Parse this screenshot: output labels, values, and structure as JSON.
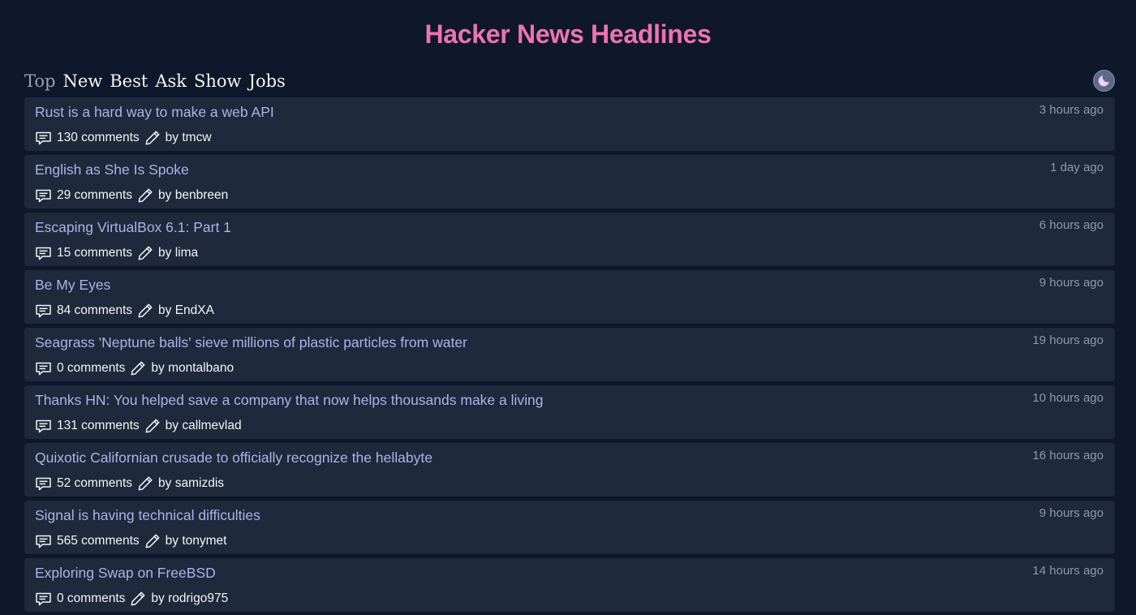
{
  "header": {
    "title": "Hacker News Headlines"
  },
  "nav": {
    "tabs": [
      {
        "label": "Top",
        "active": true
      },
      {
        "label": "New",
        "active": false
      },
      {
        "label": "Best",
        "active": false
      },
      {
        "label": "Ask",
        "active": false
      },
      {
        "label": "Show",
        "active": false
      },
      {
        "label": "Jobs",
        "active": false
      }
    ],
    "theme_toggle_icon": "moon-icon"
  },
  "colors": {
    "background": "#0f172a",
    "card": "#1e293b",
    "title_accent": "#ec73b4",
    "story_title": "#aab4e8",
    "muted_text": "#8f98aa",
    "text": "#f1f5f9"
  },
  "stories": [
    {
      "title": "Rust is a hard way to make a web API",
      "time": "3 hours ago",
      "comments": "130 comments",
      "author": "by tmcw"
    },
    {
      "title": "English as She Is Spoke",
      "time": "1 day ago",
      "comments": "29 comments",
      "author": "by benbreen"
    },
    {
      "title": "Escaping VirtualBox 6.1: Part 1",
      "time": "6 hours ago",
      "comments": "15 comments",
      "author": "by lima"
    },
    {
      "title": "Be My Eyes",
      "time": "9 hours ago",
      "comments": "84 comments",
      "author": "by EndXA"
    },
    {
      "title": "Seagrass 'Neptune balls' sieve millions of plastic particles from water",
      "time": "19 hours ago",
      "comments": "0 comments",
      "author": "by montalbano"
    },
    {
      "title": "Thanks HN: You helped save a company that now helps thousands make a living",
      "time": "10 hours ago",
      "comments": "131 comments",
      "author": "by callmevlad"
    },
    {
      "title": "Quixotic Californian crusade to officially recognize the hellabyte",
      "time": "16 hours ago",
      "comments": "52 comments",
      "author": "by samizdis"
    },
    {
      "title": "Signal is having technical difficulties",
      "time": "9 hours ago",
      "comments": "565 comments",
      "author": "by tonymet"
    },
    {
      "title": "Exploring Swap on FreeBSD",
      "time": "14 hours ago",
      "comments": "0 comments",
      "author": "by rodrigo975"
    }
  ]
}
